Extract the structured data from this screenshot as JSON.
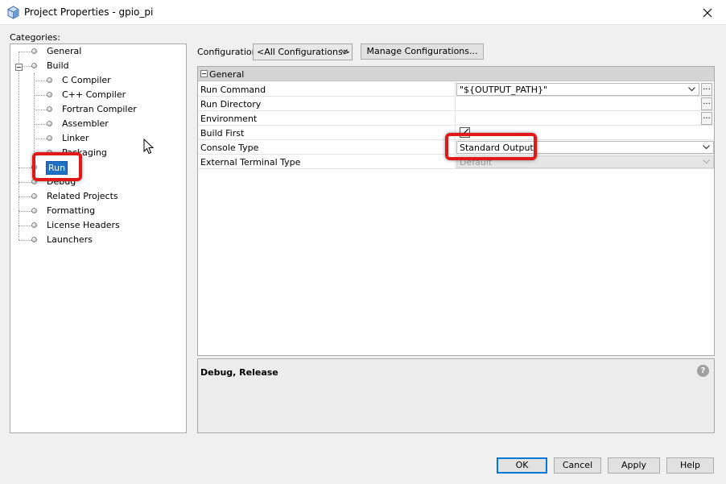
{
  "window": {
    "title": "Project Properties - gpio_pi",
    "icon": "cube-icon"
  },
  "categories": {
    "label": "Categories:",
    "items": [
      {
        "label": "General",
        "level": 0
      },
      {
        "label": "Build",
        "level": 0,
        "expanded": true
      },
      {
        "label": "C Compiler",
        "level": 1
      },
      {
        "label": "C++ Compiler",
        "level": 1
      },
      {
        "label": "Fortran Compiler",
        "level": 1
      },
      {
        "label": "Assembler",
        "level": 1
      },
      {
        "label": "Linker",
        "level": 1
      },
      {
        "label": "Packaging",
        "level": 1
      },
      {
        "label": "Run",
        "level": 0,
        "selected": true
      },
      {
        "label": "Debug",
        "level": 0
      },
      {
        "label": "Related Projects",
        "level": 0
      },
      {
        "label": "Formatting",
        "level": 0
      },
      {
        "label": "License Headers",
        "level": 0
      },
      {
        "label": "Launchers",
        "level": 0
      }
    ]
  },
  "configuration": {
    "label": "Configuration:",
    "selected": "<All Configurations>",
    "manage_label": "Manage Configurations..."
  },
  "properties": {
    "section": "General",
    "rows": [
      {
        "name": "Run Command",
        "value": "\"${OUTPUT_PATH}\"",
        "type": "combo-ellipsis"
      },
      {
        "name": "Run Directory",
        "value": "",
        "type": "ellipsis"
      },
      {
        "name": "Environment",
        "value": "",
        "type": "ellipsis"
      },
      {
        "name": "Build First",
        "value": "",
        "type": "checkbox",
        "checked": true
      },
      {
        "name": "Console Type",
        "value": "Standard Output",
        "type": "combo"
      },
      {
        "name": "External Terminal Type",
        "value": "Default",
        "type": "combo",
        "disabled": true
      }
    ]
  },
  "description": {
    "text": "Debug, Release"
  },
  "buttons": {
    "ok": "OK",
    "cancel": "Cancel",
    "apply": "Apply",
    "help": "Help"
  },
  "ellipsis_label": "...",
  "help_glyph": "?",
  "colors": {
    "selection": "#1f6fc5",
    "annotation_highlight": "#e01818",
    "default_button_border": "#0078d7"
  }
}
